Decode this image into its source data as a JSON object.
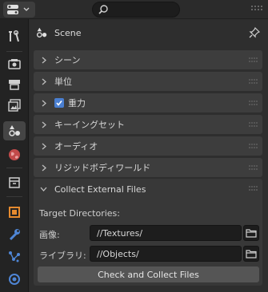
{
  "header": {
    "title": "Scene"
  },
  "panels": [
    {
      "label": "シーン"
    },
    {
      "label": "単位"
    },
    {
      "label": "重力",
      "checked": true
    },
    {
      "label": "キーイングセット"
    },
    {
      "label": "オーディオ"
    },
    {
      "label": "リジッドボディワールド"
    }
  ],
  "collect": {
    "title": "Collect External Files",
    "target_label": "Target Directories:",
    "image_label": "画像:",
    "image_path": "//Textures/",
    "library_label": "ライブラリ:",
    "library_path": "//Objects/",
    "button_label": "Check and Collect Files"
  },
  "icons": [
    "editor-type-icon",
    "search-icon",
    "tool-icon",
    "render-icon",
    "output-icon",
    "view-layer-icon",
    "scene-icon",
    "world-icon",
    "collection-icon",
    "object-icon",
    "modifier-icon",
    "particles-icon",
    "physics-icon",
    "pin-icon",
    "folder-icon"
  ],
  "colors": {
    "accent": "#4a7fd1",
    "panel": "#3d3d3d",
    "background": "#2e2e2e"
  }
}
